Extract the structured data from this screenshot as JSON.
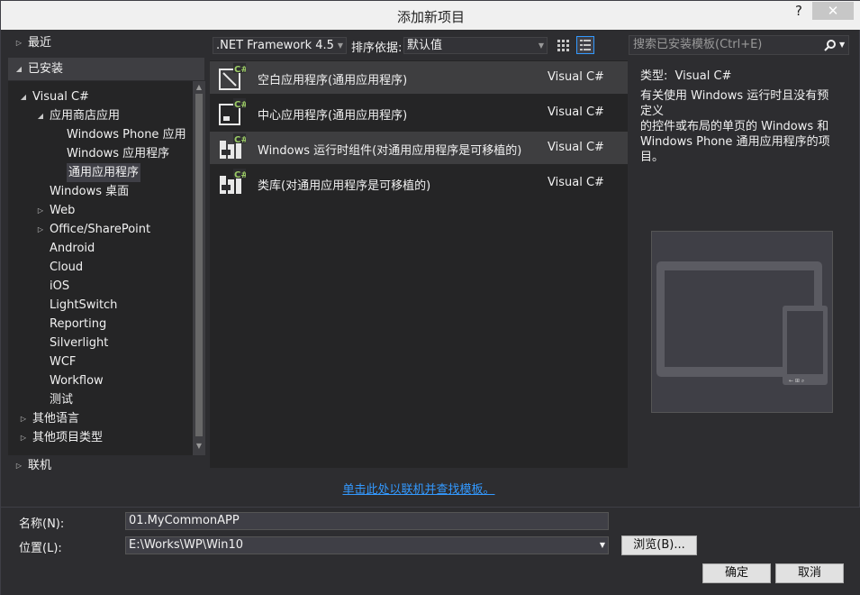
{
  "window": {
    "title": "添加新项目",
    "help": "?",
    "close": "✕"
  },
  "sidebar": {
    "recent": "最近",
    "installed": "已安装",
    "online": "联机",
    "tree": [
      {
        "label": "Visual C#",
        "indent": 1,
        "arrow": "down"
      },
      {
        "label": "应用商店应用",
        "indent": 2,
        "arrow": "down"
      },
      {
        "label": "Windows Phone 应用",
        "indent": 3,
        "arrow": ""
      },
      {
        "label": "Windows 应用程序",
        "indent": 3,
        "arrow": ""
      },
      {
        "label": "通用应用程序",
        "indent": 3,
        "arrow": "",
        "selected": true
      },
      {
        "label": "Windows 桌面",
        "indent": 2,
        "arrow": ""
      },
      {
        "label": "Web",
        "indent": 2,
        "arrow": "right"
      },
      {
        "label": "Office/SharePoint",
        "indent": 2,
        "arrow": "right"
      },
      {
        "label": "Android",
        "indent": 2,
        "arrow": ""
      },
      {
        "label": "Cloud",
        "indent": 2,
        "arrow": ""
      },
      {
        "label": "iOS",
        "indent": 2,
        "arrow": ""
      },
      {
        "label": "LightSwitch",
        "indent": 2,
        "arrow": ""
      },
      {
        "label": "Reporting",
        "indent": 2,
        "arrow": ""
      },
      {
        "label": "Silverlight",
        "indent": 2,
        "arrow": ""
      },
      {
        "label": "WCF",
        "indent": 2,
        "arrow": ""
      },
      {
        "label": "Workflow",
        "indent": 2,
        "arrow": ""
      },
      {
        "label": "测试",
        "indent": 2,
        "arrow": ""
      },
      {
        "label": "其他语言",
        "indent": 1,
        "arrow": "right"
      },
      {
        "label": "其他项目类型",
        "indent": 1,
        "arrow": "right"
      }
    ]
  },
  "toolbar": {
    "framework": ".NET Framework 4.5",
    "sort_label": "排序依据:",
    "sort_value": "默认值",
    "search_placeholder": "搜索已安装模板(Ctrl+E)"
  },
  "templates": [
    {
      "name": "空白应用程序(通用应用程序)",
      "lang": "Visual C#",
      "icon": "blank-app-icon",
      "hover": true
    },
    {
      "name": "中心应用程序(通用应用程序)",
      "lang": "Visual C#",
      "icon": "hub-app-icon",
      "hover": false
    },
    {
      "name": "Windows 运行时组件(对通用应用程序是可移植的)",
      "lang": "Visual C#",
      "icon": "runtime-component-icon",
      "hover": true
    },
    {
      "name": "类库(对通用应用程序是可移植的)",
      "lang": "Visual C#",
      "icon": "class-library-icon",
      "hover": false
    }
  ],
  "details": {
    "type_label": "类型:",
    "type_value": "Visual C#",
    "lines": [
      "有关使用 Windows 运行时且没有预定义",
      "的控件或布局的单页的 Windows 和",
      "Windows Phone 通用应用程序的项目。"
    ]
  },
  "online_link": "单击此处以联机并查找模板。",
  "form": {
    "name_label": "名称(N):",
    "name_value": "01.MyCommonAPP",
    "location_label": "位置(L):",
    "location_value": "E:\\Works\\WP\\Win10",
    "browse": "浏览(B)...",
    "ok": "确定",
    "cancel": "取消"
  },
  "colors": {
    "accent": "#3399ff",
    "background": "#2d2d30",
    "panel": "#252526",
    "csharp_badge": "#9ccc65"
  }
}
